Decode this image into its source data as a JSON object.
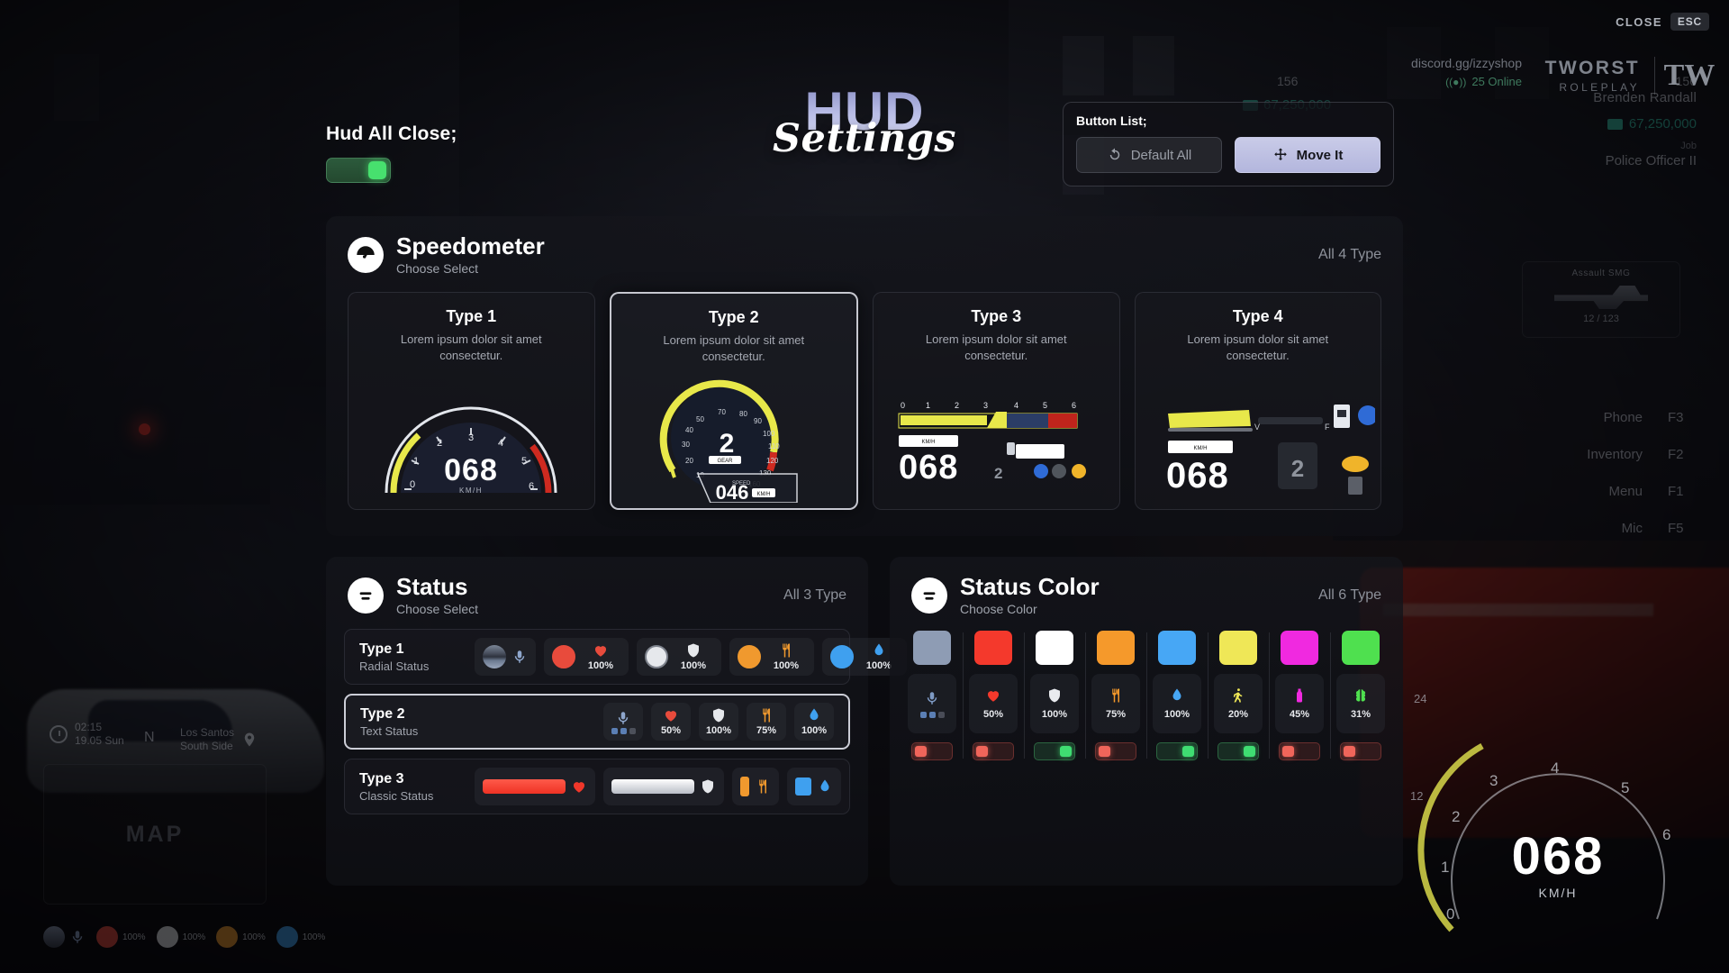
{
  "window": {
    "close_label": "CLOSE",
    "close_key": "ESC"
  },
  "branding": {
    "discord_url": "discord.gg/izzyshop",
    "online": "25 Online",
    "wifi_icon": "broadcast-icon",
    "server_name": "TWORST",
    "server_sub": "ROLEPLAY",
    "logo_mark": "TW"
  },
  "title": {
    "main": "HUD",
    "script": "Settings"
  },
  "hud_all_close": {
    "label": "Hud All Close;",
    "state": "on"
  },
  "button_list": {
    "title": "Button List;",
    "default_all": "Default All",
    "default_all_icon": "reset-icon",
    "move_it": "Move It",
    "move_it_icon": "move-arrows-icon"
  },
  "speedometer": {
    "icon": "speedometer-icon",
    "title": "Speedometer",
    "subtitle": "Choose Select",
    "count": "All 4 Type",
    "selected_index": 1,
    "cards": [
      {
        "title": "Type 1",
        "desc": "Lorem ipsum dolor sit amet consectetur.",
        "art": "radial-gauge",
        "speed": "068",
        "unit": "KM/H",
        "gear": "",
        "selected": false
      },
      {
        "title": "Type 2",
        "desc": "Lorem ipsum dolor sit amet consectetur.",
        "art": "radial-gauge-gear",
        "speed": "046",
        "unit": "KM/H",
        "gear": "2",
        "selected": true
      },
      {
        "title": "Type 3",
        "desc": "Lorem ipsum dolor sit amet consectetur.",
        "art": "bar-gauge",
        "speed": "068",
        "unit": "KM/H",
        "gear": "2",
        "selected": false
      },
      {
        "title": "Type 4",
        "desc": "Lorem ipsum dolor sit amet consectetur.",
        "art": "compact-gauge",
        "speed": "068",
        "unit": "KM/H",
        "gear": "2",
        "selected": false
      }
    ]
  },
  "status": {
    "icon": "list-icon",
    "title": "Status",
    "subtitle": "Choose Select",
    "count": "All 3 Type",
    "selected_index": 1,
    "rows": [
      {
        "title": "Type 1",
        "subtitle": "Radial Status",
        "style": "radial",
        "selected": false,
        "items": [
          {
            "icon": "microphone-icon",
            "value": "",
            "color": "#6f8bb8"
          },
          {
            "icon": "heart-icon",
            "value": "100%",
            "color": "#e84b3c"
          },
          {
            "icon": "shield-icon",
            "value": "100%",
            "color": "#e6e8ec"
          },
          {
            "icon": "food-icon",
            "value": "100%",
            "color": "#f0992e"
          },
          {
            "icon": "water-icon",
            "value": "100%",
            "color": "#3fa0ef"
          }
        ]
      },
      {
        "title": "Type 2",
        "subtitle": "Text Status",
        "style": "text",
        "selected": true,
        "items": [
          {
            "icon": "microphone-icon",
            "value": "",
            "color": "#6f8bb8"
          },
          {
            "icon": "heart-icon",
            "value": "50%",
            "color": "#e84b3c"
          },
          {
            "icon": "shield-icon",
            "value": "100%",
            "color": "#e6e8ec"
          },
          {
            "icon": "food-icon",
            "value": "75%",
            "color": "#f0992e"
          },
          {
            "icon": "water-icon",
            "value": "100%",
            "color": "#3fa0ef"
          }
        ]
      },
      {
        "title": "Type 3",
        "subtitle": "Classic Status",
        "style": "classic",
        "selected": false,
        "items": [
          {
            "icon": "heart-icon",
            "value": "",
            "color": "#f0372a"
          },
          {
            "icon": "shield-icon",
            "value": "",
            "color": "#e6e8ec"
          },
          {
            "icon": "food-icon",
            "value": "",
            "color": "#f0992e"
          },
          {
            "icon": "water-icon",
            "value": "",
            "color": "#3fa0ef"
          }
        ]
      }
    ]
  },
  "status_color": {
    "icon": "list-icon",
    "title": "Status Color",
    "subtitle": "Choose Color",
    "count": "All 6 Type",
    "columns": [
      {
        "name": "voice",
        "swatch": "#8e9cb4",
        "icon": "microphone-icon",
        "icon_color": "#7e9ac4",
        "value": "",
        "toggle": "off"
      },
      {
        "name": "health",
        "swatch": "#f4392c",
        "icon": "heart-icon",
        "icon_color": "#f4392c",
        "value": "50%",
        "toggle": "off"
      },
      {
        "name": "armor",
        "swatch": "#ffffff",
        "icon": "shield-icon",
        "icon_color": "#e9ebef",
        "value": "100%",
        "toggle": "on"
      },
      {
        "name": "hunger",
        "swatch": "#f5992b",
        "icon": "food-icon",
        "icon_color": "#f5992b",
        "value": "75%",
        "toggle": "off"
      },
      {
        "name": "thirst",
        "swatch": "#47a7f5",
        "icon": "water-icon",
        "icon_color": "#47a7f5",
        "value": "100%",
        "toggle": "on"
      },
      {
        "name": "stamina",
        "swatch": "#efe757",
        "icon": "run-icon",
        "icon_color": "#efe757",
        "value": "20%",
        "toggle": "on"
      },
      {
        "name": "oxygen",
        "swatch": "#f029e0",
        "icon": "bottle-icon",
        "icon_color": "#f029e0",
        "value": "45%",
        "toggle": "off"
      },
      {
        "name": "stress",
        "swatch": "#4fe04f",
        "icon": "brain-icon",
        "icon_color": "#4fe04f",
        "value": "31%",
        "toggle": "off"
      }
    ]
  },
  "game_hud": {
    "player_name": "Brenden Randall",
    "player_id": "156",
    "money": "67,250,000",
    "bank": "67,250,000",
    "job_label": "Job",
    "job_value": "Police Officer II",
    "weapon_name": "Assault SMG",
    "weapon_ammo": "12 / 123",
    "keybinds": [
      {
        "label": "Phone",
        "key": "F3"
      },
      {
        "label": "Inventory",
        "key": "F2"
      },
      {
        "label": "Menu",
        "key": "F1"
      },
      {
        "label": "Mic",
        "key": "F5"
      }
    ],
    "map_label": "MAP",
    "clock_time": "02:15",
    "clock_date": "19.05 Sun",
    "location_street": "Los Santos",
    "location_zone": "South Side",
    "compass": "N",
    "speed": "068",
    "speed_unit": "KM/H",
    "statusbar": [
      {
        "icon": "microphone-icon",
        "value": ""
      },
      {
        "icon": "heart-icon",
        "value": "100%"
      },
      {
        "icon": "shield-icon",
        "value": "100%"
      },
      {
        "icon": "food-icon",
        "value": "100%"
      },
      {
        "icon": "water-icon",
        "value": "100%"
      }
    ]
  }
}
